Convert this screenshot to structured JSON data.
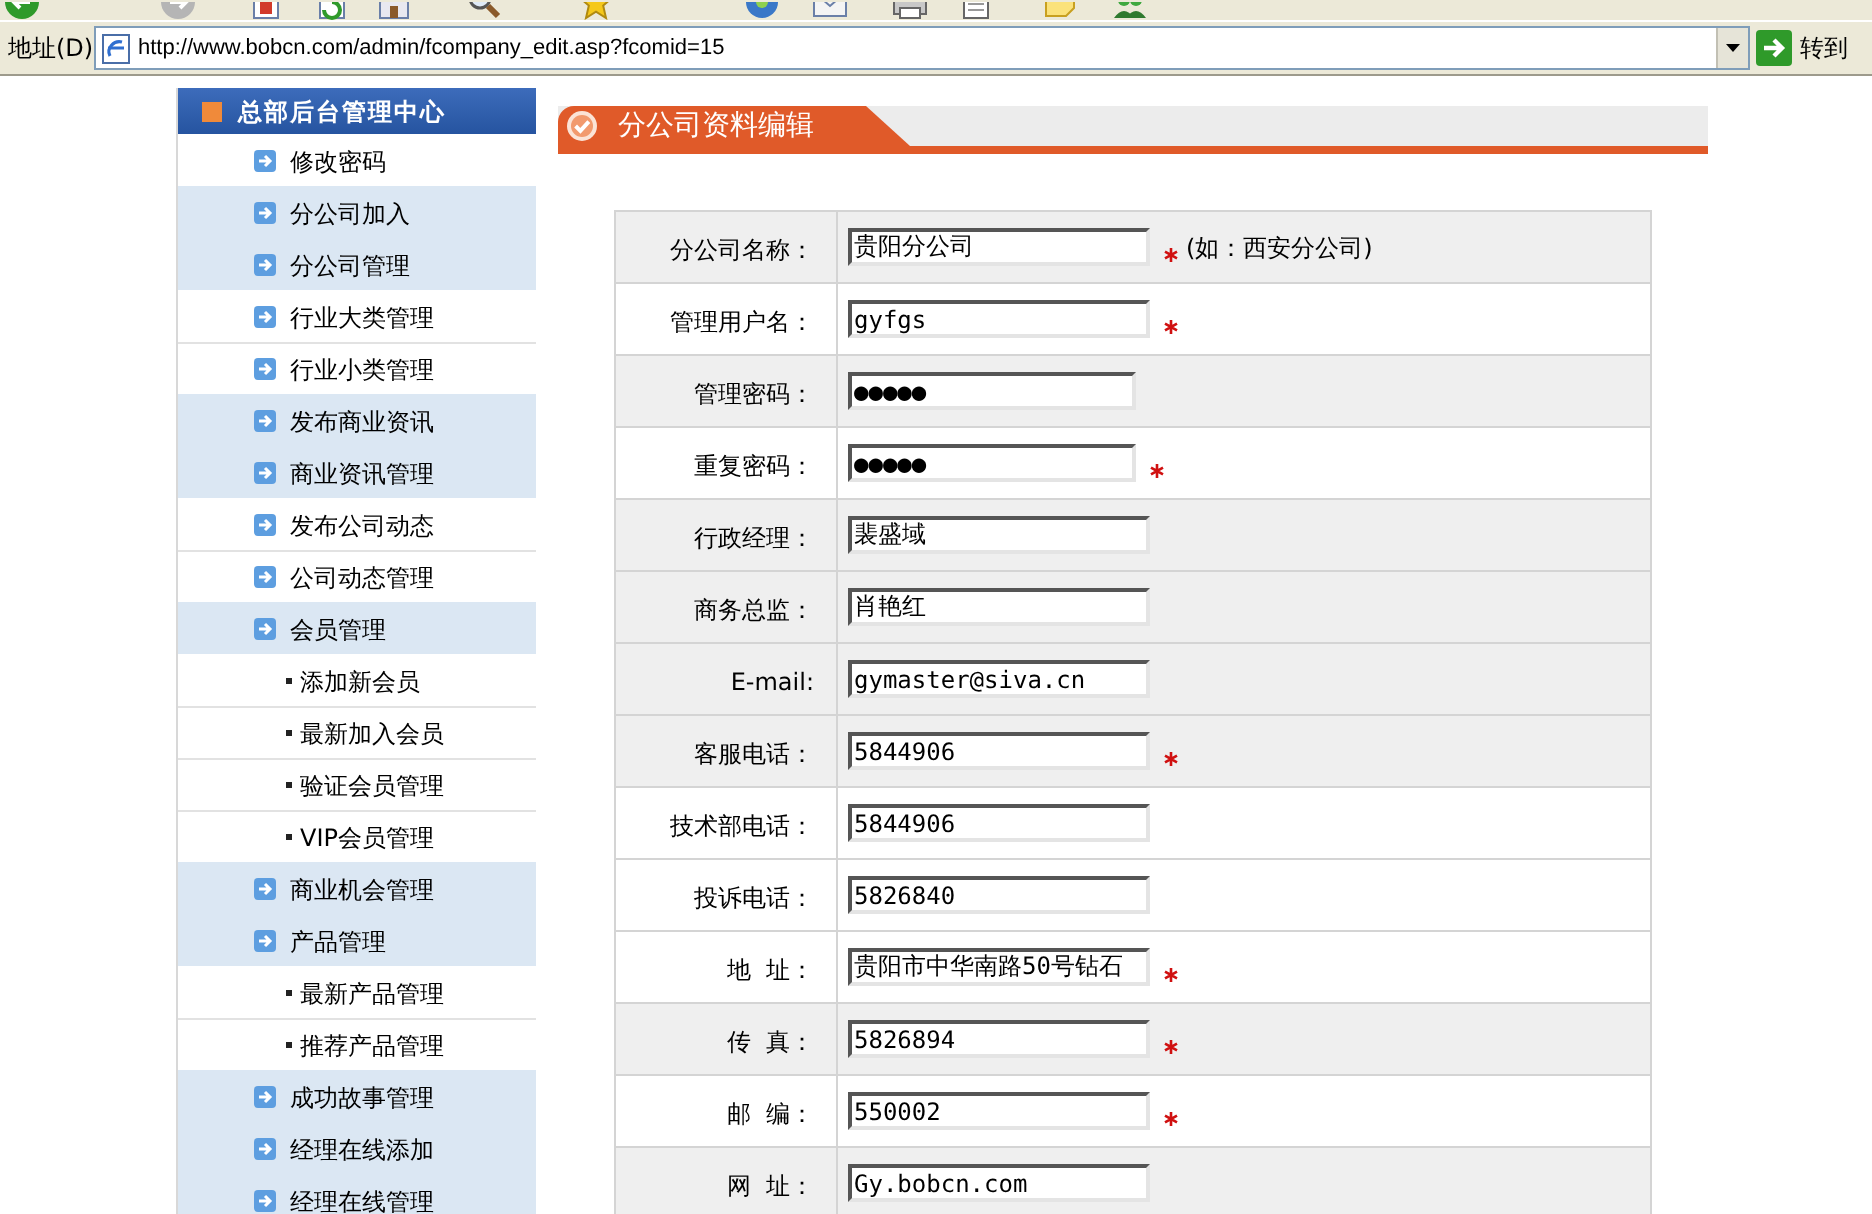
{
  "browser": {
    "address_label": "地址(D)",
    "url": "http://www.bobcn.com/admin/fcompany_edit.asp?fcomid=15",
    "go_button": "转到"
  },
  "sidebar": {
    "title": "总部后台管理中心",
    "items": [
      {
        "label": "修改密码",
        "kind": "link",
        "shaded": false
      },
      {
        "label": "分公司加入",
        "kind": "link",
        "shaded": true
      },
      {
        "label": "分公司管理",
        "kind": "link",
        "shaded": true
      },
      {
        "label": "行业大类管理",
        "kind": "link",
        "shaded": false
      },
      {
        "label": "行业小类管理",
        "kind": "link",
        "shaded": false
      },
      {
        "label": "发布商业资讯",
        "kind": "link",
        "shaded": true
      },
      {
        "label": "商业资讯管理",
        "kind": "link",
        "shaded": true
      },
      {
        "label": "发布公司动态",
        "kind": "link",
        "shaded": false
      },
      {
        "label": "公司动态管理",
        "kind": "link",
        "shaded": false
      },
      {
        "label": "会员管理",
        "kind": "link",
        "shaded": true
      },
      {
        "label": "添加新会员",
        "kind": "sub",
        "shaded": false
      },
      {
        "label": "最新加入会员",
        "kind": "sub",
        "shaded": false
      },
      {
        "label": "验证会员管理",
        "kind": "sub",
        "shaded": false
      },
      {
        "label": "VIP会员管理",
        "kind": "sub",
        "shaded": false
      },
      {
        "label": "商业机会管理",
        "kind": "link",
        "shaded": true
      },
      {
        "label": "产品管理",
        "kind": "link",
        "shaded": true
      },
      {
        "label": "最新产品管理",
        "kind": "sub",
        "shaded": false
      },
      {
        "label": "推荐产品管理",
        "kind": "sub",
        "shaded": false
      },
      {
        "label": "成功故事管理",
        "kind": "link",
        "shaded": true
      },
      {
        "label": "经理在线添加",
        "kind": "link",
        "shaded": true
      },
      {
        "label": "经理在线管理",
        "kind": "link",
        "shaded": true
      }
    ]
  },
  "section": {
    "title": "分公司资料编辑"
  },
  "form": {
    "rows": [
      {
        "label": "分公司名称：",
        "kind": "text",
        "value": "贵阳分公司",
        "required": true,
        "hint": "(如：西安分公司)",
        "shaded": true
      },
      {
        "label": "管理用户名：",
        "kind": "text",
        "value": "gyfgs",
        "required": true,
        "shaded": false
      },
      {
        "label": "管理密码：",
        "kind": "password",
        "value": "●●●●●",
        "required": false,
        "shaded": true
      },
      {
        "label": "重复密码：",
        "kind": "password",
        "value": "●●●●●",
        "required": true,
        "shaded": false
      },
      {
        "label": "行政经理：",
        "kind": "text",
        "value": "裴盛域",
        "required": false,
        "shaded": true
      },
      {
        "label": "商务总监：",
        "kind": "text",
        "value": "肖艳红",
        "required": false,
        "shaded": true
      },
      {
        "label": "E-mail:",
        "kind": "text",
        "value": "gymaster@siva.cn",
        "required": false,
        "shaded": true
      },
      {
        "label": "客服电话：",
        "kind": "text",
        "value": "5844906",
        "required": true,
        "shaded": true
      },
      {
        "label": "技术部电话：",
        "kind": "text",
        "value": "5844906",
        "required": false,
        "shaded": false
      },
      {
        "label": "投诉电话：",
        "kind": "text",
        "value": "5826840",
        "required": false,
        "shaded": false
      },
      {
        "label": "地  址：",
        "kind": "text",
        "value": "贵阳市中华南路50号钻石",
        "required": true,
        "shaded": false
      },
      {
        "label": "传  真：",
        "kind": "text",
        "value": "5826894",
        "required": true,
        "shaded": true
      },
      {
        "label": "邮  编：",
        "kind": "text",
        "value": "550002",
        "required": true,
        "shaded": false
      },
      {
        "label": "网  址：",
        "kind": "text",
        "value": "Gy.bobcn.com",
        "required": false,
        "shaded": true
      }
    ]
  }
}
